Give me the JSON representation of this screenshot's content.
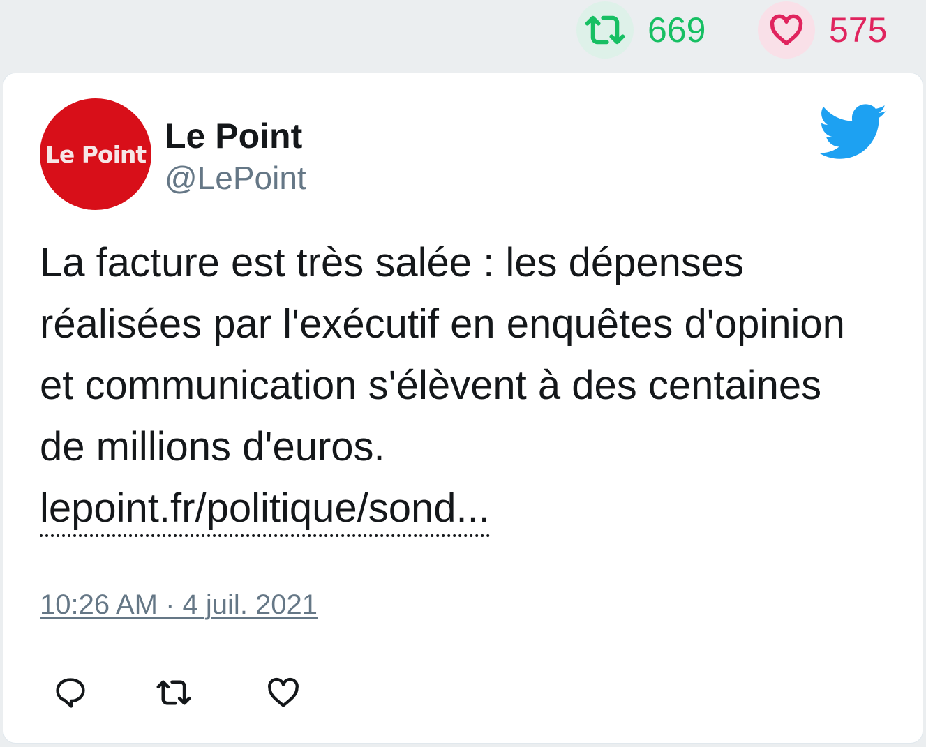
{
  "top_stats": {
    "retweet_count": "669",
    "like_count": "575",
    "retweet_color": "#17bf63",
    "like_color": "#e0245e"
  },
  "tweet": {
    "avatar_text": "Le Point",
    "display_name": "Le Point",
    "handle": "@LePoint",
    "text": "La facture est très salée : les dépenses réalisées par l'exécutif en enquêtes d'opinion et communication s'élèvent à des centaines de millions d'euros.",
    "link": "lepoint.fr/politique/sond...",
    "timestamp": "10:26 AM · 4 juil. 2021"
  },
  "icons": {
    "platform": "twitter-bird-icon",
    "retweet": "retweet-icon",
    "like": "heart-icon",
    "reply": "reply-icon"
  },
  "colors": {
    "avatar_bg": "#d80f19",
    "bird": "#1da1f2",
    "text": "#14171a",
    "muted": "#657786"
  }
}
